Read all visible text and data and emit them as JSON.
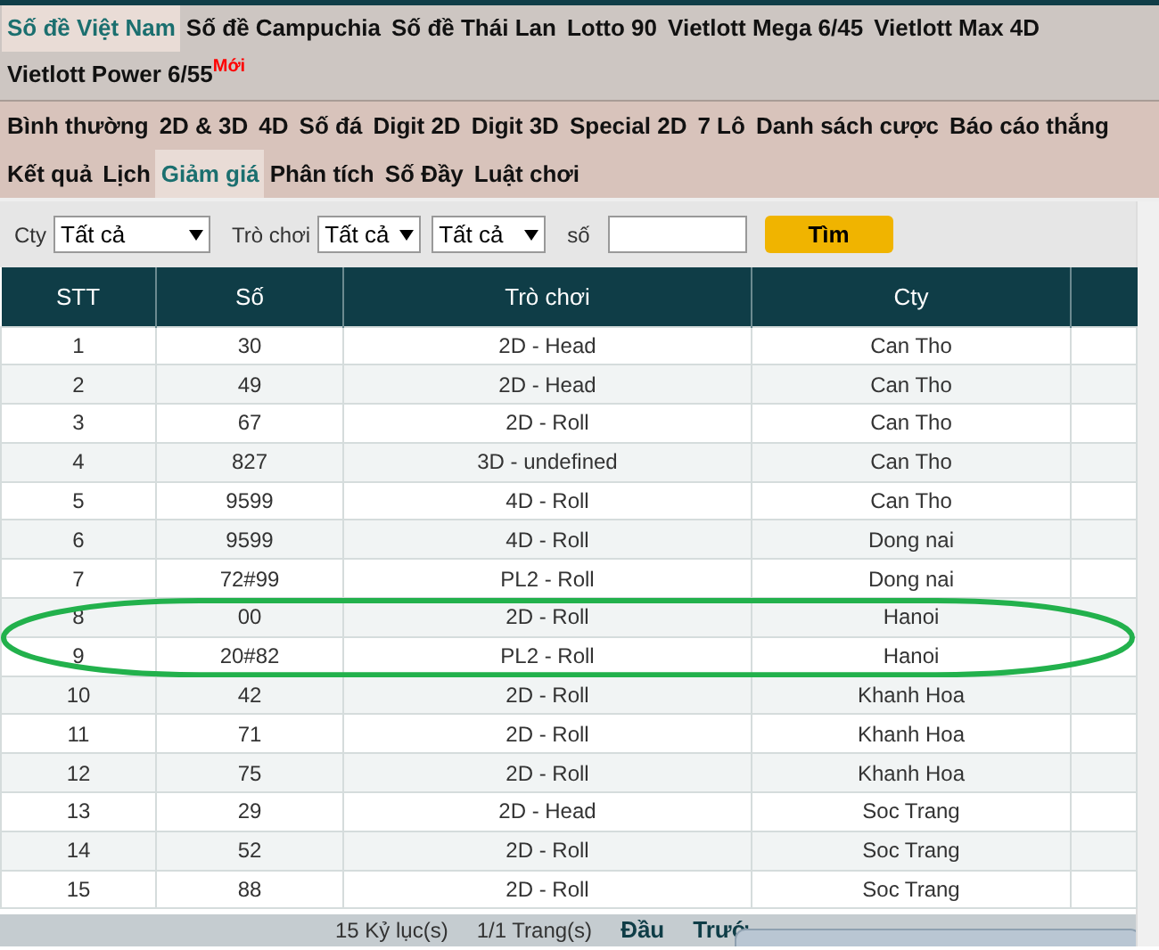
{
  "nav_primary": [
    {
      "label": "Số đề Việt Nam",
      "selected": true
    },
    {
      "label": "Số đề Campuchia",
      "selected": false
    },
    {
      "label": "Số đề Thái Lan",
      "selected": false
    },
    {
      "label": "Lotto 90",
      "selected": false
    },
    {
      "label": "Vietlott Mega 6/45",
      "selected": false
    },
    {
      "label": "Vietlott Max 4D",
      "selected": false
    },
    {
      "label": "Vietlott Power 6/55",
      "selected": false,
      "badge": "Mới"
    }
  ],
  "nav_secondary": [
    {
      "label": "Bình thường",
      "selected": false
    },
    {
      "label": "2D & 3D",
      "selected": false
    },
    {
      "label": "4D",
      "selected": false
    },
    {
      "label": "Số đá",
      "selected": false
    },
    {
      "label": "Digit 2D",
      "selected": false
    },
    {
      "label": "Digit 3D",
      "selected": false
    },
    {
      "label": "Special 2D",
      "selected": false
    },
    {
      "label": "7 Lô",
      "selected": false
    },
    {
      "label": "Danh sách cược",
      "selected": false
    },
    {
      "label": "Báo cáo thắng",
      "selected": false
    },
    {
      "label": "Kết quả",
      "selected": false
    },
    {
      "label": "Lịch",
      "selected": false
    },
    {
      "label": "Giảm giá",
      "selected": true
    },
    {
      "label": "Phân tích",
      "selected": false
    },
    {
      "label": "Số Đầy",
      "selected": false
    },
    {
      "label": "Luật chơi",
      "selected": false
    }
  ],
  "filters": {
    "cty_label": "Cty",
    "cty_value": "Tất cả",
    "game_label": "Trò chơi",
    "game_value": "Tất cả",
    "game_value_2": "Tất cả",
    "number_label": "số",
    "search_button": "Tìm"
  },
  "table": {
    "columns": [
      "STT",
      "Số",
      "Trò chơi",
      "Cty"
    ],
    "rows": [
      {
        "cells": [
          "1",
          "30",
          "2D - Head",
          "Can Tho"
        ]
      },
      {
        "cells": [
          "2",
          "49",
          "2D - Head",
          "Can Tho"
        ]
      },
      {
        "cells": [
          "3",
          "67",
          "2D - Roll",
          "Can Tho"
        ]
      },
      {
        "cells": [
          "4",
          "827",
          "3D - undefined",
          "Can Tho"
        ]
      },
      {
        "cells": [
          "5",
          "9599",
          "4D - Roll",
          "Can Tho"
        ]
      },
      {
        "cells": [
          "6",
          "9599",
          "4D - Roll",
          "Dong nai"
        ]
      },
      {
        "cells": [
          "7",
          "72#99",
          "PL2 - Roll",
          "Dong nai"
        ]
      },
      {
        "cells": [
          "8",
          "00",
          "2D - Roll",
          "Hanoi"
        ]
      },
      {
        "cells": [
          "9",
          "20#82",
          "PL2 - Roll",
          "Hanoi"
        ]
      },
      {
        "cells": [
          "10",
          "42",
          "2D - Roll",
          "Khanh Hoa"
        ]
      },
      {
        "cells": [
          "11",
          "71",
          "2D - Roll",
          "Khanh Hoa"
        ]
      },
      {
        "cells": [
          "12",
          "75",
          "2D - Roll",
          "Khanh Hoa"
        ]
      },
      {
        "cells": [
          "13",
          "29",
          "2D - Head",
          "Soc Trang"
        ]
      },
      {
        "cells": [
          "14",
          "52",
          "2D - Roll",
          "Soc Trang"
        ]
      },
      {
        "cells": [
          "15",
          "88",
          "2D - Roll",
          "Soc Trang"
        ]
      }
    ]
  },
  "annotation": {
    "kind": "ellipse"
  },
  "pager": {
    "records": "15 Kỷ lục(s)",
    "pages": "1/1 Trang(s)",
    "links": [
      "Đầu",
      "Trướ"
    ]
  }
}
